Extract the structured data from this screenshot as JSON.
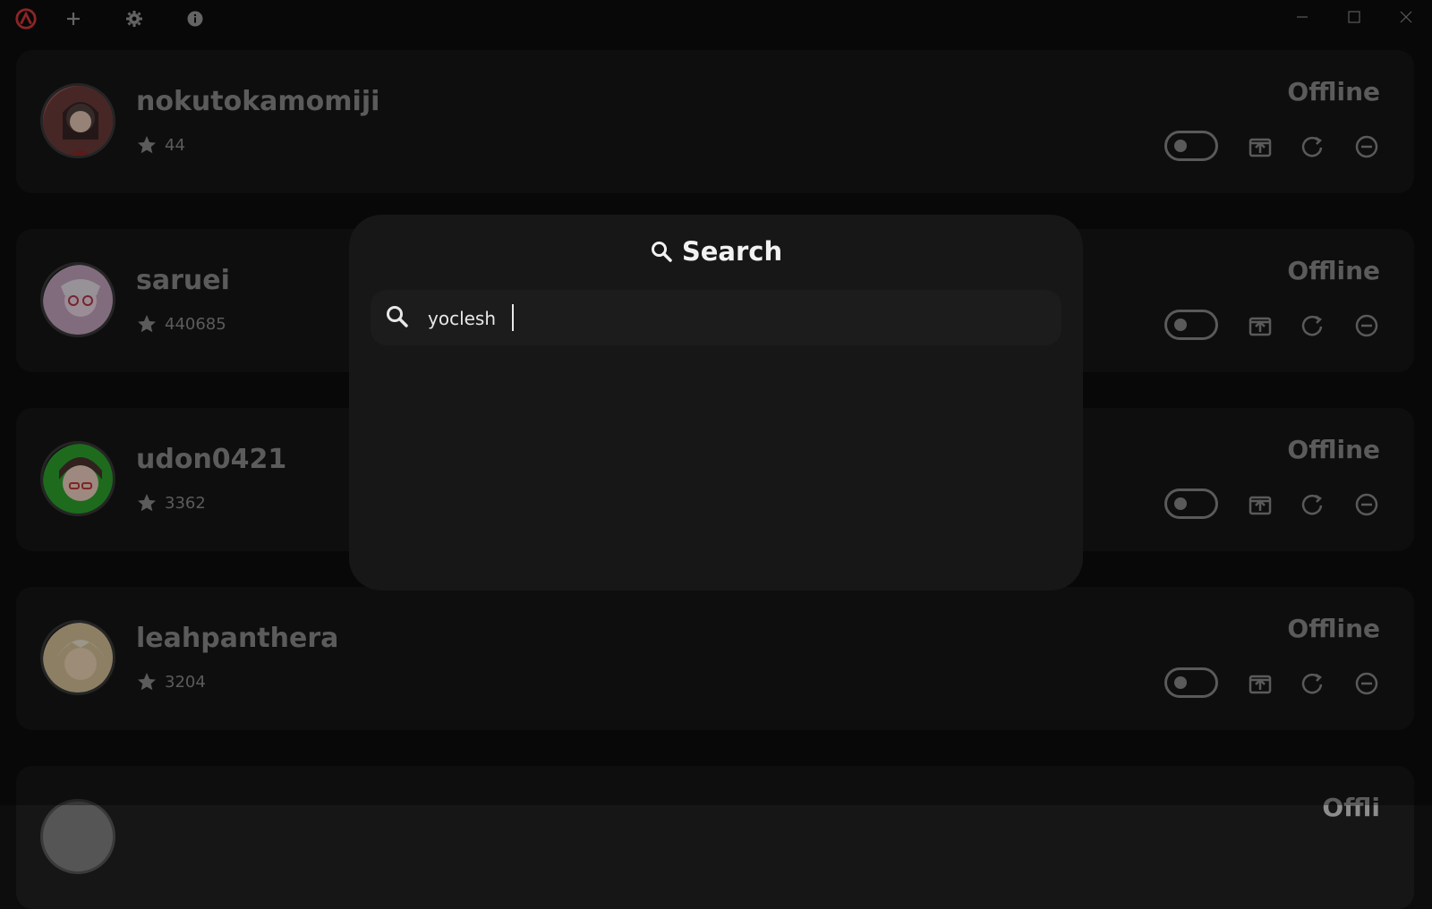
{
  "titlebar": {
    "icons": [
      "app-logo-icon",
      "plus-icon",
      "gear-icon",
      "info-icon"
    ],
    "window_controls": [
      "minimize-icon",
      "maximize-icon",
      "close-icon"
    ]
  },
  "channels": [
    {
      "name": "nokutokamomiji",
      "count": "44",
      "status": "Offline",
      "avatar_color": "#b05a5a"
    },
    {
      "name": "saruei",
      "count": "440685",
      "status": "Offline",
      "avatar_color": "#c7a7c2"
    },
    {
      "name": "udon0421",
      "count": "3362",
      "status": "Offline",
      "avatar_color": "#3e9b3e"
    },
    {
      "name": "leahpanthera",
      "count": "3204",
      "status": "Offline",
      "avatar_color": "#d8c39a"
    },
    {
      "name": "",
      "count": "",
      "status": "Offli",
      "avatar_color": "#555555"
    }
  ],
  "row_actions": [
    "toggle",
    "upload-icon",
    "refresh-icon",
    "remove-icon"
  ],
  "search_modal": {
    "title": "Search",
    "input_value": "yoclesh"
  },
  "colors": {
    "background": "#0d0d0d",
    "card": "#161616",
    "modal": "#171717",
    "text_muted": "#8d8d8d",
    "accent_logo": "#d93a3a"
  }
}
